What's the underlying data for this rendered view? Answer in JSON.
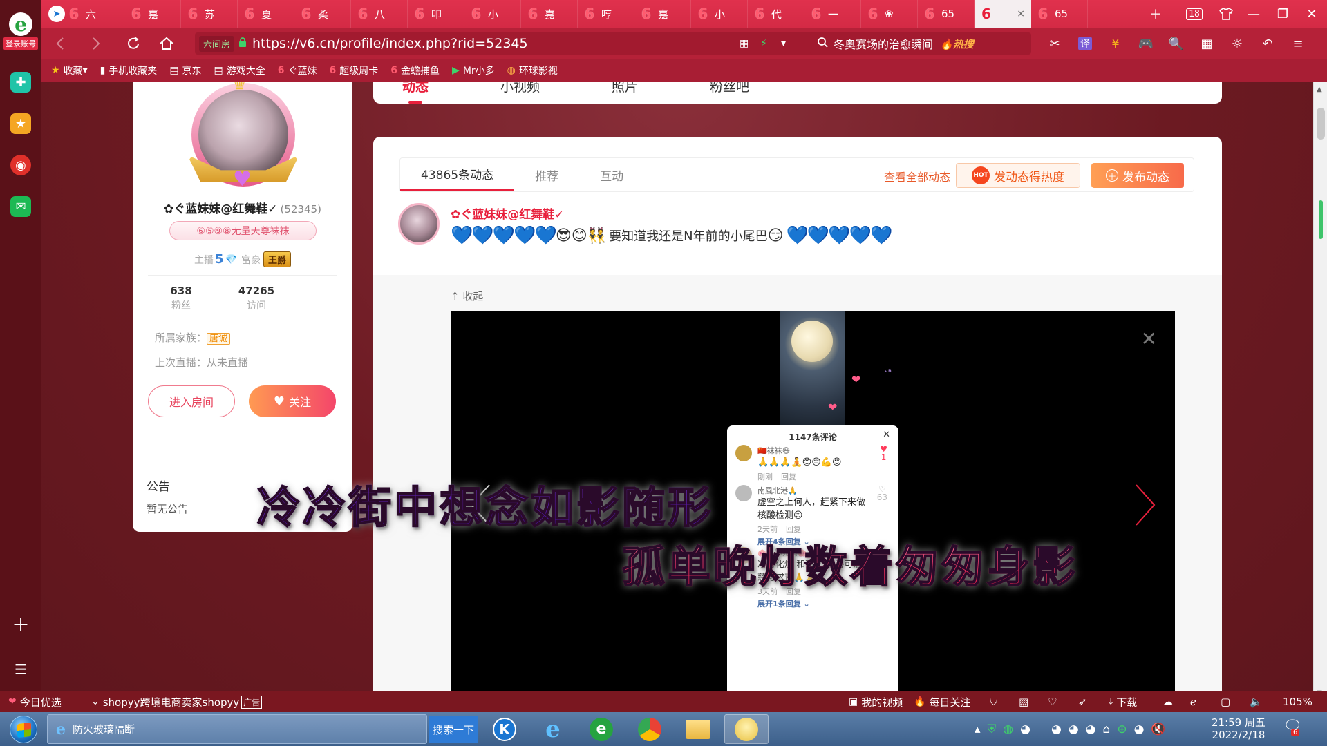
{
  "browser": {
    "logo_label": "登录账号",
    "tabs": [
      {
        "label": "六",
        "icon": "v6-favicon"
      },
      {
        "label": "嘉",
        "icon": "v6-favicon"
      },
      {
        "label": "苏",
        "icon": "v6-favicon"
      },
      {
        "label": "夏",
        "icon": "v6-favicon"
      },
      {
        "label": "柔",
        "icon": "v6-favicon"
      },
      {
        "label": "八",
        "icon": "v6-favicon"
      },
      {
        "label": "叩",
        "icon": "v6-favicon"
      },
      {
        "label": "小",
        "icon": "v6-favicon"
      },
      {
        "label": "嘉",
        "icon": "v6-favicon"
      },
      {
        "label": "哼",
        "icon": "v6-favicon"
      },
      {
        "label": "嘉",
        "icon": "v6-favicon"
      },
      {
        "label": "小",
        "icon": "v6-favicon"
      },
      {
        "label": "代",
        "icon": "v6-favicon"
      },
      {
        "label": "一",
        "icon": "v6-favicon"
      },
      {
        "label": "❀",
        "icon": "v6-favicon"
      },
      {
        "label": "65",
        "icon": "v6-favicon"
      },
      {
        "label": "",
        "icon": "v6-favicon",
        "active": true,
        "close": "×"
      },
      {
        "label": "65",
        "icon": "v6-favicon"
      }
    ],
    "tab_count_badge": "18",
    "url": "https://v6.cn/profile/index.php?rid=52345",
    "security_label": "六间房",
    "search_text": "冬奥赛场的治愈瞬间",
    "search_hot": "热搜",
    "bookmarks": [
      {
        "label": "收藏",
        "icon": "star-icon"
      },
      {
        "label": "手机收藏夹",
        "icon": "phone-icon"
      },
      {
        "label": "京东",
        "icon": "doc-icon"
      },
      {
        "label": "游戏大全",
        "icon": "doc-icon"
      },
      {
        "label": "ぐ蓝妹",
        "icon": "v6-favicon"
      },
      {
        "label": "超级周卡",
        "icon": "v6-favicon"
      },
      {
        "label": "金蟾捕鱼",
        "icon": "v6-favicon"
      },
      {
        "label": "Mr小多",
        "icon": "play-icon"
      },
      {
        "label": "环球影视",
        "icon": "globe-icon"
      }
    ],
    "colors": {
      "tabstrip": "#d42a45",
      "accent": "#e8203c",
      "orange": "#f76a4a"
    }
  },
  "profile": {
    "name": "✿ぐ蓝妹妹@红舞鞋✓",
    "rid": "(52345)",
    "title_badge": "⑥⑤⑨⑧无量天尊袜袜",
    "rank_anchor_label": "主播",
    "rank_anchor_level": "5",
    "rank_rich_label": "富豪",
    "rank_rich_value": "王爵",
    "fans_count": "638",
    "fans_label": "粉丝",
    "visits_count": "47265",
    "visits_label": "访问",
    "family_label": "所属家族：",
    "family_value": "唐诚",
    "last_live_label": "上次直播：从未直播",
    "enter_room": "进入房间",
    "follow": "关注"
  },
  "notice": {
    "title": "公告",
    "content": "暂无公告"
  },
  "main_tabs": [
    "动态",
    "小视频",
    "照片",
    "粉丝吧"
  ],
  "feed": {
    "tabs": [
      "43865条动态",
      "推荐",
      "互动"
    ],
    "view_all": "查看全部动态",
    "hot_button": "发动态得热度",
    "hot_badge": "HOT",
    "publish_button": "发布动态",
    "post": {
      "author": "✿ぐ蓝妹妹@红舞鞋✓",
      "emojis_before": "💙💙💙💙💙",
      "emojis_mid": "😎😊👯",
      "text": "要知道我还是N年前的小尾巴",
      "emoji_smile": "😏",
      "emojis_after": "💙💙💙💙💙",
      "collapse": "收起"
    }
  },
  "viewer": {
    "comments_title": "1147条评论",
    "comments": [
      {
        "user": "🇨🇳袜袜😄",
        "text": "🙏🙏🙏🧘😊😔💪😍",
        "time": "刚刚",
        "reply": "回复",
        "likes": "1",
        "liked": true
      },
      {
        "user": "南風北港🙏",
        "text": "虚空之上何人，赶紧下来做核酸检测😊",
        "time": "2天前",
        "reply": "回复",
        "likes": "63",
        "more": "展开4条回复"
      },
      {
        "user": "🐽小😸她妈🐽",
        "text": "净可化燥 和可化凶 善可治恶 慈可求吉🙏🙏🙏",
        "time": "3天前",
        "reply": "回复",
        "likes": "64",
        "more": "展开1条回复"
      }
    ]
  },
  "lyrics": {
    "line1": "冷冷街中想念如影随形",
    "line2": "孤单晚灯数着匆匆身影"
  },
  "statusbar": {
    "today": "今日优选",
    "ad": "shopyy跨境电商卖家shopyy",
    "ad_tag": "广告",
    "my_video": "我的视频",
    "daily": "每日关注",
    "download": "下载",
    "zoom": "105%"
  },
  "taskbar": {
    "active_window": "防火玻璃隔断",
    "search": "搜索一下",
    "time": "21:59 周五",
    "date": "2022/2/18",
    "notif_count": "6"
  }
}
